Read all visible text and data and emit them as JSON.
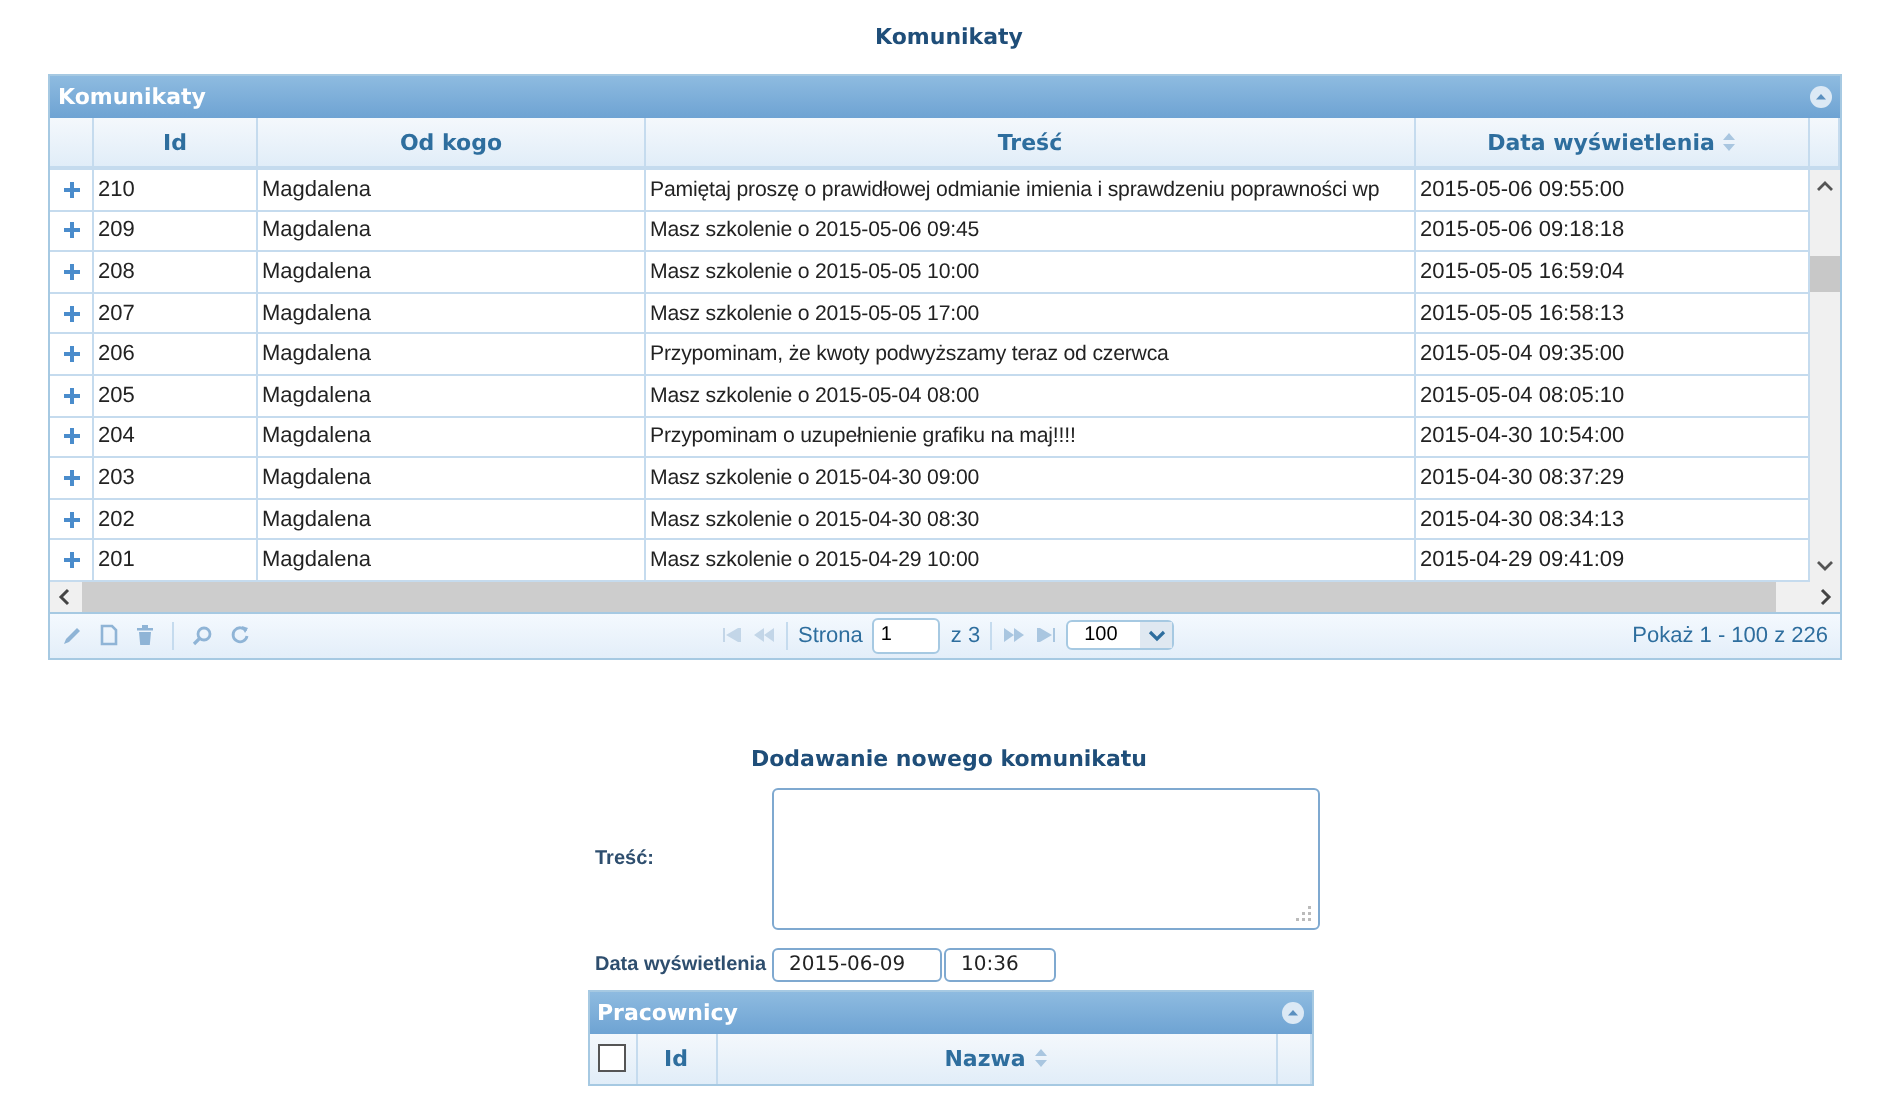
{
  "page_title": "Komunikaty",
  "messages_grid": {
    "caption": "Komunikaty",
    "columns": [
      {
        "label": "Id",
        "sortable": false
      },
      {
        "label": "Od kogo",
        "sortable": false
      },
      {
        "label": "Treść",
        "sortable": false
      },
      {
        "label": "Data wyświetlenia",
        "sortable": true
      }
    ],
    "rows": [
      {
        "id": "210",
        "from": "Magdalena",
        "content": "Pamiętaj proszę o prawidłowej odmianie imienia i sprawdzeniu poprawności wp",
        "date": "2015-05-06 09:55:00"
      },
      {
        "id": "209",
        "from": "Magdalena",
        "content": "Masz szkolenie o 2015-05-06 09:45",
        "date": "2015-05-06 09:18:18"
      },
      {
        "id": "208",
        "from": "Magdalena",
        "content": "Masz szkolenie o 2015-05-05 10:00",
        "date": "2015-05-05 16:59:04"
      },
      {
        "id": "207",
        "from": "Magdalena",
        "content": "Masz szkolenie o 2015-05-05 17:00",
        "date": "2015-05-05 16:58:13"
      },
      {
        "id": "206",
        "from": "Magdalena",
        "content": "Przypominam, że kwoty podwyższamy teraz od czerwca",
        "date": "2015-05-04 09:35:00"
      },
      {
        "id": "205",
        "from": "Magdalena",
        "content": "Masz szkolenie o 2015-05-04 08:00",
        "date": "2015-05-04 08:05:10"
      },
      {
        "id": "204",
        "from": "Magdalena",
        "content": "Przypominam o uzupełnienie grafiku na maj!!!!",
        "date": "2015-04-30 10:54:00"
      },
      {
        "id": "203",
        "from": "Magdalena",
        "content": "Masz szkolenie o 2015-04-30 09:00",
        "date": "2015-04-30 08:37:29"
      },
      {
        "id": "202",
        "from": "Magdalena",
        "content": "Masz szkolenie o 2015-04-30 08:30",
        "date": "2015-04-30 08:34:13"
      },
      {
        "id": "201",
        "from": "Magdalena",
        "content": "Masz szkolenie o 2015-04-29 10:00",
        "date": "2015-04-29 09:41:09"
      }
    ],
    "pager": {
      "page_label": "Strona",
      "page": "1",
      "page_count": "z 3",
      "page_size": "100",
      "summary": "Pokaż 1 - 100 z 226"
    }
  },
  "form": {
    "title": "Dodawanie nowego komunikatu",
    "content_label": "Treść:",
    "date_label": "Data wyświetlenia",
    "date": "2015-06-09",
    "time": "10:36"
  },
  "employees_grid": {
    "caption": "Pracownicy",
    "select_all_checked": false,
    "columns": [
      {
        "label": "Id",
        "sortable": false
      },
      {
        "label": "Nazwa",
        "sortable": true
      }
    ]
  }
}
